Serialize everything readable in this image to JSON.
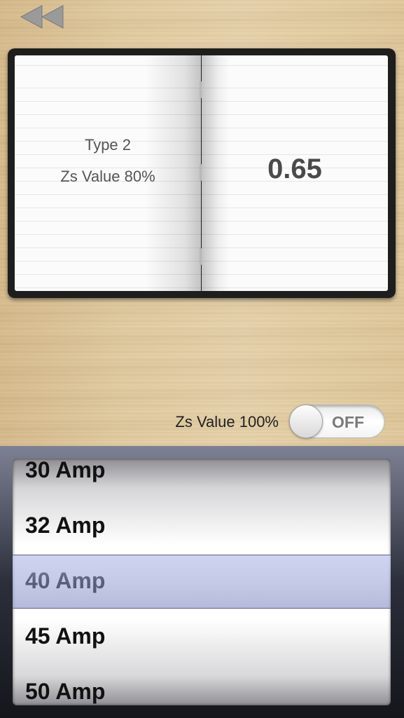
{
  "nav": {
    "back_icon": "rewind-double-chevron-icon"
  },
  "book": {
    "left_line1": "Type 2",
    "left_line2": "Zs Value 80%",
    "right_value": "0.65"
  },
  "toggle": {
    "label": "Zs Value 100%",
    "state_text": "OFF",
    "on": false
  },
  "picker": {
    "items": [
      "30 Amp",
      "32 Amp",
      "40 Amp",
      "45 Amp",
      "50 Amp"
    ],
    "selected": "40 Amp"
  }
}
